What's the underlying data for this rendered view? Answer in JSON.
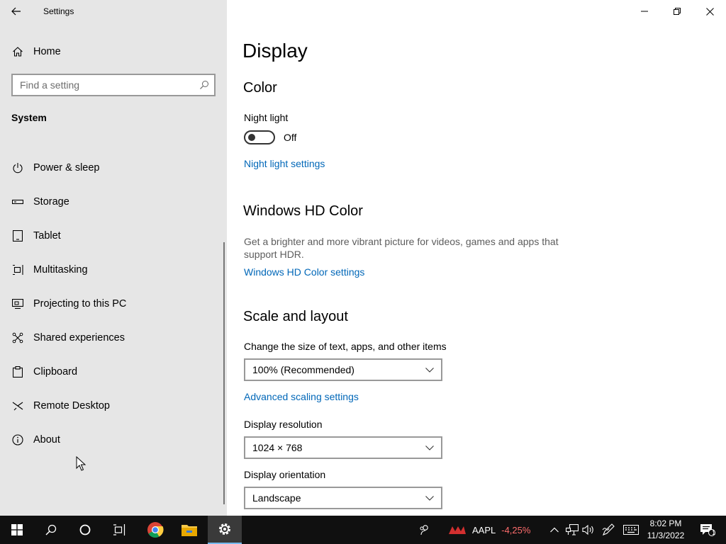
{
  "window": {
    "title": "Settings"
  },
  "sidebar": {
    "home_label": "Home",
    "search_placeholder": "Find a setting",
    "group_title": "System",
    "items": [
      {
        "label": "Power & sleep",
        "icon": "power-icon"
      },
      {
        "label": "Storage",
        "icon": "storage-icon"
      },
      {
        "label": "Tablet",
        "icon": "tablet-icon"
      },
      {
        "label": "Multitasking",
        "icon": "multitasking-icon"
      },
      {
        "label": "Projecting to this PC",
        "icon": "projecting-icon"
      },
      {
        "label": "Shared experiences",
        "icon": "shared-experiences-icon"
      },
      {
        "label": "Clipboard",
        "icon": "clipboard-icon"
      },
      {
        "label": "Remote Desktop",
        "icon": "remote-desktop-icon"
      },
      {
        "label": "About",
        "icon": "about-icon"
      }
    ]
  },
  "main": {
    "page_title": "Display",
    "color": {
      "title": "Color",
      "night_light_label": "Night light",
      "night_light_state": "Off",
      "night_light_on": false,
      "night_light_link": "Night light settings"
    },
    "hd_color": {
      "title": "Windows HD Color",
      "description": "Get a brighter and more vibrant picture for videos, games and apps that support HDR.",
      "link": "Windows HD Color settings"
    },
    "scale": {
      "title": "Scale and layout",
      "size_label": "Change the size of text, apps, and other items",
      "size_value": "100% (Recommended)",
      "advanced_link": "Advanced scaling settings",
      "resolution_label": "Display resolution",
      "resolution_value": "1024 × 768",
      "orientation_label": "Display orientation",
      "orientation_value": "Landscape"
    }
  },
  "taskbar": {
    "stock_symbol": "AAPL",
    "stock_change": "-4,25%",
    "time": "8:02 PM",
    "date": "11/3/2022",
    "notification_count": "1"
  },
  "colors": {
    "accent": "#0067b8",
    "sidebar_bg": "#e6e6e6",
    "taskbar_bg": "#101010",
    "stock_negative": "#ff6d6d"
  }
}
